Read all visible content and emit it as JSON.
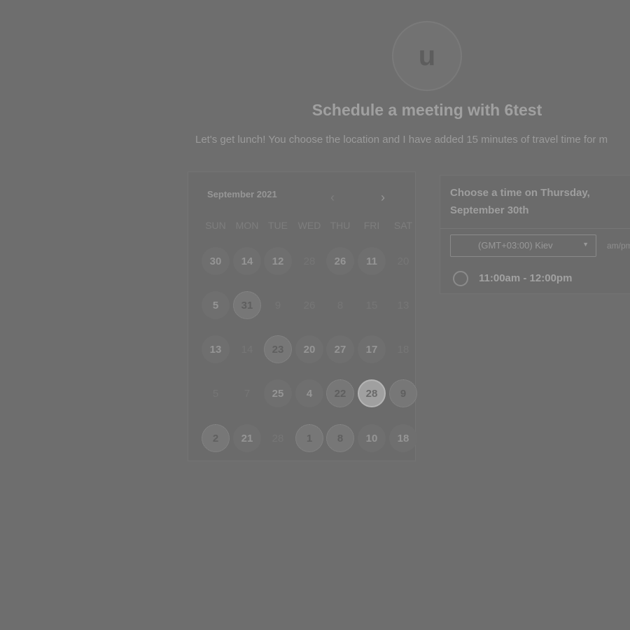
{
  "avatar": {
    "initial": "u"
  },
  "header": {
    "title": "Schedule a meeting with 6test",
    "subtitle": "Let's get lunch! You choose the location and I have added 15 minutes of travel time for m"
  },
  "calendar": {
    "month_label": "September 2021",
    "prev_icon": "‹",
    "next_icon": "›",
    "weekdays": [
      "SUN",
      "MON",
      "TUE",
      "WED",
      "THU",
      "FRI",
      "SAT"
    ],
    "weeks": [
      [
        {
          "text": "30",
          "state": "avail"
        },
        {
          "text": "14",
          "state": "avail"
        },
        {
          "text": "12",
          "state": "avail"
        },
        {
          "text": "28",
          "state": "muted"
        },
        {
          "text": "26",
          "state": "avail"
        },
        {
          "text": "11",
          "state": "avail"
        },
        {
          "text": "20",
          "state": "muted"
        }
      ],
      [
        {
          "text": "5",
          "state": "avail"
        },
        {
          "text": "31",
          "state": "noisy"
        },
        {
          "text": "9",
          "state": "muted"
        },
        {
          "text": "26",
          "state": "muted"
        },
        {
          "text": "8",
          "state": "muted"
        },
        {
          "text": "15",
          "state": "muted"
        },
        {
          "text": "13",
          "state": "muted"
        }
      ],
      [
        {
          "text": "13",
          "state": "avail"
        },
        {
          "text": "14",
          "state": "muted"
        },
        {
          "text": "23",
          "state": "noisy"
        },
        {
          "text": "20",
          "state": "avail"
        },
        {
          "text": "27",
          "state": "avail"
        },
        {
          "text": "17",
          "state": "avail"
        },
        {
          "text": "18",
          "state": "muted"
        }
      ],
      [
        {
          "text": "5",
          "state": "muted"
        },
        {
          "text": "7",
          "state": "muted"
        },
        {
          "text": "25",
          "state": "avail"
        },
        {
          "text": "4",
          "state": "avail"
        },
        {
          "text": "22",
          "state": "noisy"
        },
        {
          "text": "28",
          "state": "selected"
        },
        {
          "text": "9",
          "state": "noisy"
        }
      ],
      [
        {
          "text": "2",
          "state": "noisy"
        },
        {
          "text": "21",
          "state": "avail"
        },
        {
          "text": "28",
          "state": "muted"
        },
        {
          "text": "1",
          "state": "noisy"
        },
        {
          "text": "8",
          "state": "noisy"
        },
        {
          "text": "10",
          "state": "avail"
        },
        {
          "text": "18",
          "state": "avail"
        }
      ]
    ]
  },
  "time_panel": {
    "title": "Choose a time on Thursday, September 30th",
    "timezone": "(GMT+03:00) Kiev",
    "caret_icon": "▼",
    "format_toggle": "am/pm",
    "slots": [
      {
        "label": "11:00am - 12:00pm"
      }
    ]
  }
}
